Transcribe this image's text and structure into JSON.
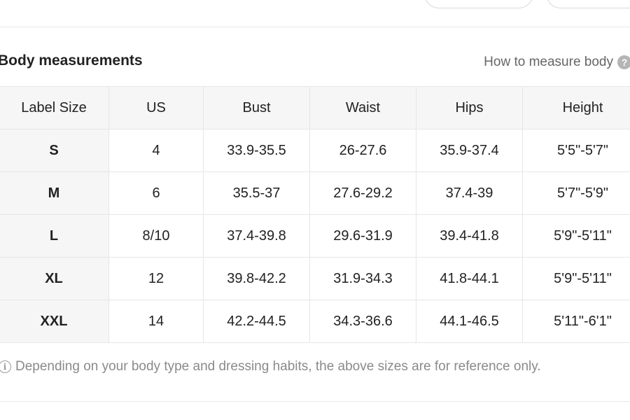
{
  "section": {
    "title": "Body measurements",
    "measure_link": "How to measure body",
    "help_icon": "?",
    "help_icon_name": "question-circle-icon"
  },
  "table": {
    "headers": [
      "Label Size",
      "US",
      "Bust",
      "Waist",
      "Hips",
      "Height"
    ],
    "rows": [
      [
        "S",
        "4",
        "33.9-35.5",
        "26-27.6",
        "35.9-37.4",
        "5'5\"-5'7\""
      ],
      [
        "M",
        "6",
        "35.5-37",
        "27.6-29.2",
        "37.4-39",
        "5'7\"-5'9\""
      ],
      [
        "L",
        "8/10",
        "37.4-39.8",
        "29.6-31.9",
        "39.4-41.8",
        "5'9\"-5'11\""
      ],
      [
        "XL",
        "12",
        "39.8-42.2",
        "31.9-34.3",
        "41.8-44.1",
        "5'9\"-5'11\""
      ],
      [
        "XXL",
        "14",
        "42.2-44.5",
        "34.3-36.6",
        "44.1-46.5",
        "5'11\"-6'1\""
      ]
    ]
  },
  "note": {
    "text": "Depending on your body type and dressing habits, the above sizes are for reference only.",
    "icon": "i",
    "icon_name": "info-circle-icon"
  },
  "colors": {
    "header_bg": "#f6f6f6",
    "border": "#e6e6e6",
    "muted_text": "#8a8a8a"
  }
}
